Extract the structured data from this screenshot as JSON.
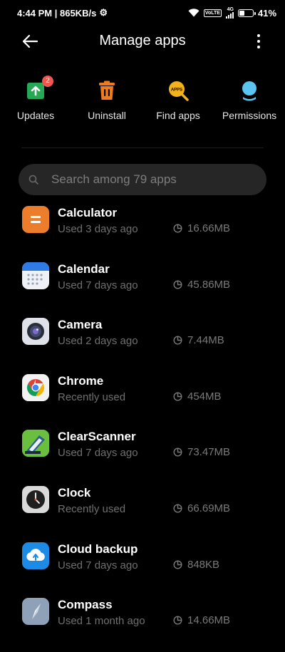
{
  "status_bar": {
    "time_speed": "4:44 PM | 865KB/s",
    "network": "4G",
    "volte": "VoLTE",
    "battery": "41",
    "battery_level": 0.41
  },
  "header": {
    "title": "Manage apps"
  },
  "actions": [
    {
      "label": "Updates",
      "badge": "2",
      "icon": "updates-icon"
    },
    {
      "label": "Uninstall",
      "icon": "trash-icon"
    },
    {
      "label": "Find apps",
      "icon": "find-apps-icon",
      "icon_text": "APPS"
    },
    {
      "label": "Permissions",
      "icon": "permissions-icon"
    }
  ],
  "search": {
    "placeholder": "Search among 79 apps"
  },
  "apps": [
    {
      "name": "Calculator",
      "sub": "Used 3 days ago",
      "size": "16.66MB",
      "icon": "calculator-icon"
    },
    {
      "name": "Calendar",
      "sub": "Used 7 days ago",
      "size": "45.86MB",
      "icon": "calendar-icon"
    },
    {
      "name": "Camera",
      "sub": "Used 2 days ago",
      "size": "7.44MB",
      "icon": "camera-icon"
    },
    {
      "name": "Chrome",
      "sub": "Recently used",
      "size": "454MB",
      "icon": "chrome-icon"
    },
    {
      "name": "ClearScanner",
      "sub": "Used 7 days ago",
      "size": "73.47MB",
      "icon": "clearscanner-icon"
    },
    {
      "name": "Clock",
      "sub": "Recently used",
      "size": "66.69MB",
      "icon": "clock-icon"
    },
    {
      "name": "Cloud backup",
      "sub": "Used 7 days ago",
      "size": "848KB",
      "icon": "cloud-backup-icon"
    },
    {
      "name": "Compass",
      "sub": "Used 1 month ago",
      "size": "14.66MB",
      "icon": "compass-icon"
    }
  ],
  "colors": {
    "background": "#000000",
    "update_green": "#27a854",
    "badge_red": "#f0584f",
    "uninstall_orange": "#f07b1e",
    "find_yellow": "#f3b21b",
    "permission_blue": "#5bc4f0",
    "subtext": "#6f6f6f"
  }
}
